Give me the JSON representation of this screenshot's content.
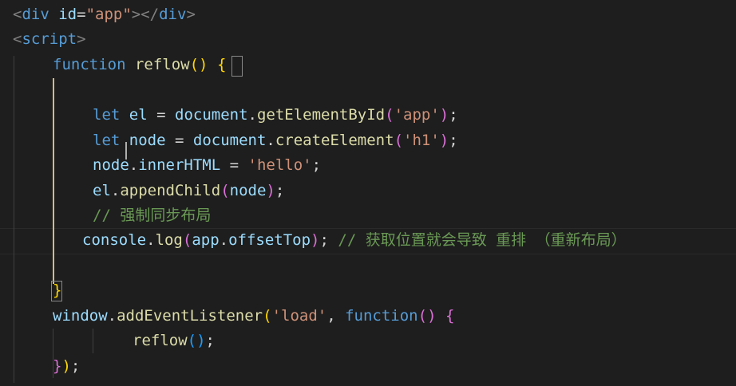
{
  "lines": [
    {
      "tokens": [
        {
          "t": "<",
          "c": "k-punc"
        },
        {
          "t": "div",
          "c": "k-tag"
        },
        {
          "t": " ",
          "c": "k-plain"
        },
        {
          "t": "id",
          "c": "k-attr"
        },
        {
          "t": "=",
          "c": "k-plain"
        },
        {
          "t": "\"app\"",
          "c": "k-str"
        },
        {
          "t": "></",
          "c": "k-punc"
        },
        {
          "t": "div",
          "c": "k-tag"
        },
        {
          "t": ">",
          "c": "k-punc"
        }
      ]
    },
    {
      "tokens": [
        {
          "t": "<",
          "c": "k-punc"
        },
        {
          "t": "script",
          "c": "k-tag"
        },
        {
          "t": ">",
          "c": "k-punc"
        }
      ]
    },
    {
      "tokens": [
        {
          "t": "function",
          "c": "k-kw"
        },
        {
          "t": " ",
          "c": "k-plain"
        },
        {
          "t": "reflow",
          "c": "k-fn"
        },
        {
          "t": "()",
          "c": "k-brk1"
        },
        {
          "t": " ",
          "c": "k-plain"
        },
        {
          "t": "{",
          "c": "k-brk1"
        }
      ]
    },
    {
      "tokens": []
    },
    {
      "tokens": [
        {
          "t": "let",
          "c": "k-kw"
        },
        {
          "t": " ",
          "c": "k-plain"
        },
        {
          "t": "el",
          "c": "k-var"
        },
        {
          "t": " = ",
          "c": "k-plain"
        },
        {
          "t": "document",
          "c": "k-var"
        },
        {
          "t": ".",
          "c": "k-plain"
        },
        {
          "t": "getElementById",
          "c": "k-fn"
        },
        {
          "t": "(",
          "c": "k-brk2"
        },
        {
          "t": "'app'",
          "c": "k-str"
        },
        {
          "t": ")",
          "c": "k-brk2"
        },
        {
          "t": ";",
          "c": "k-plain"
        }
      ]
    },
    {
      "tokens": [
        {
          "t": "let",
          "c": "k-kw"
        },
        {
          "t": " ",
          "c": "k-plain"
        },
        {
          "t": "node",
          "c": "k-var"
        },
        {
          "t": " = ",
          "c": "k-plain"
        },
        {
          "t": "document",
          "c": "k-var"
        },
        {
          "t": ".",
          "c": "k-plain"
        },
        {
          "t": "createElement",
          "c": "k-fn"
        },
        {
          "t": "(",
          "c": "k-brk2"
        },
        {
          "t": "'h1'",
          "c": "k-str"
        },
        {
          "t": ")",
          "c": "k-brk2"
        },
        {
          "t": ";",
          "c": "k-plain"
        }
      ]
    },
    {
      "tokens": [
        {
          "t": "node",
          "c": "k-var"
        },
        {
          "t": ".",
          "c": "k-plain"
        },
        {
          "t": "innerHTML",
          "c": "k-var"
        },
        {
          "t": " = ",
          "c": "k-plain"
        },
        {
          "t": "'hello'",
          "c": "k-str"
        },
        {
          "t": ";",
          "c": "k-plain"
        }
      ]
    },
    {
      "tokens": [
        {
          "t": "el",
          "c": "k-var"
        },
        {
          "t": ".",
          "c": "k-plain"
        },
        {
          "t": "appendChild",
          "c": "k-fn"
        },
        {
          "t": "(",
          "c": "k-brk2"
        },
        {
          "t": "node",
          "c": "k-var"
        },
        {
          "t": ")",
          "c": "k-brk2"
        },
        {
          "t": ";",
          "c": "k-plain"
        }
      ]
    },
    {
      "tokens": [
        {
          "t": "// 强制同步布局",
          "c": "k-comment"
        }
      ]
    },
    {
      "tokens": [
        {
          "t": "console",
          "c": "k-var"
        },
        {
          "t": ".",
          "c": "k-plain"
        },
        {
          "t": "log",
          "c": "k-fn"
        },
        {
          "t": "(",
          "c": "k-brk2"
        },
        {
          "t": "app",
          "c": "k-var"
        },
        {
          "t": ".",
          "c": "k-plain"
        },
        {
          "t": "offsetTop",
          "c": "k-var"
        },
        {
          "t": ")",
          "c": "k-brk2"
        },
        {
          "t": "; ",
          "c": "k-plain"
        },
        {
          "t": "// 获取位置就会导致 重排 （重新布局）",
          "c": "k-comment"
        }
      ]
    },
    {
      "tokens": []
    },
    {
      "tokens": [
        {
          "t": "}",
          "c": "k-brk1"
        }
      ]
    },
    {
      "tokens": [
        {
          "t": "window",
          "c": "k-var"
        },
        {
          "t": ".",
          "c": "k-plain"
        },
        {
          "t": "addEventListener",
          "c": "k-fn"
        },
        {
          "t": "(",
          "c": "k-brk1"
        },
        {
          "t": "'load'",
          "c": "k-str"
        },
        {
          "t": ", ",
          "c": "k-plain"
        },
        {
          "t": "function",
          "c": "k-kw"
        },
        {
          "t": "()",
          "c": "k-brk2"
        },
        {
          "t": " ",
          "c": "k-plain"
        },
        {
          "t": "{",
          "c": "k-brk2"
        }
      ]
    },
    {
      "tokens": [
        {
          "t": "reflow",
          "c": "k-fn"
        },
        {
          "t": "()",
          "c": "k-brk3"
        },
        {
          "t": ";",
          "c": "k-plain"
        }
      ]
    },
    {
      "tokens": [
        {
          "t": "}",
          "c": "k-brk2"
        },
        {
          "t": ")",
          "c": "k-brk1"
        },
        {
          "t": ";",
          "c": "k-plain"
        }
      ]
    }
  ]
}
